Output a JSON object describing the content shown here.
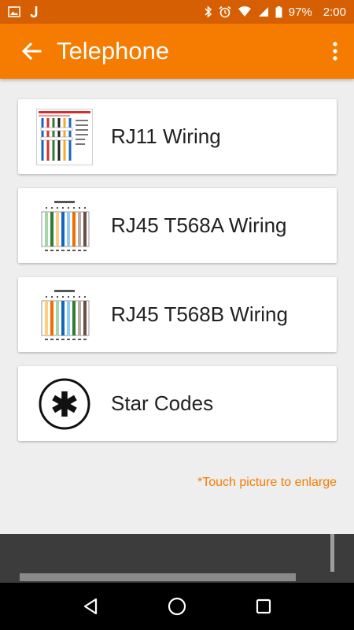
{
  "status_bar": {
    "battery": "97%",
    "time": "2:00",
    "icons": [
      "gallery-icon",
      "j-app-icon",
      "bluetooth-icon",
      "alarm-icon",
      "wifi-icon",
      "signal-icon",
      "battery-icon"
    ]
  },
  "app_bar": {
    "title": "Telephone"
  },
  "items": [
    {
      "label": "RJ11 Wiring",
      "icon": "rj11-diagram"
    },
    {
      "label": "RJ45 T568A Wiring",
      "icon": "rj45-t568a-diagram"
    },
    {
      "label": "RJ45 T568B Wiring",
      "icon": "rj45-t568b-diagram"
    },
    {
      "label": "Star Codes",
      "icon": "star-circle-icon"
    }
  ],
  "hint": "*Touch picture to enlarge",
  "colors": {
    "status_bar": "#d65f04",
    "app_bar": "#f57c00",
    "accent_text": "#f57c00",
    "background": "#eeeeee"
  }
}
